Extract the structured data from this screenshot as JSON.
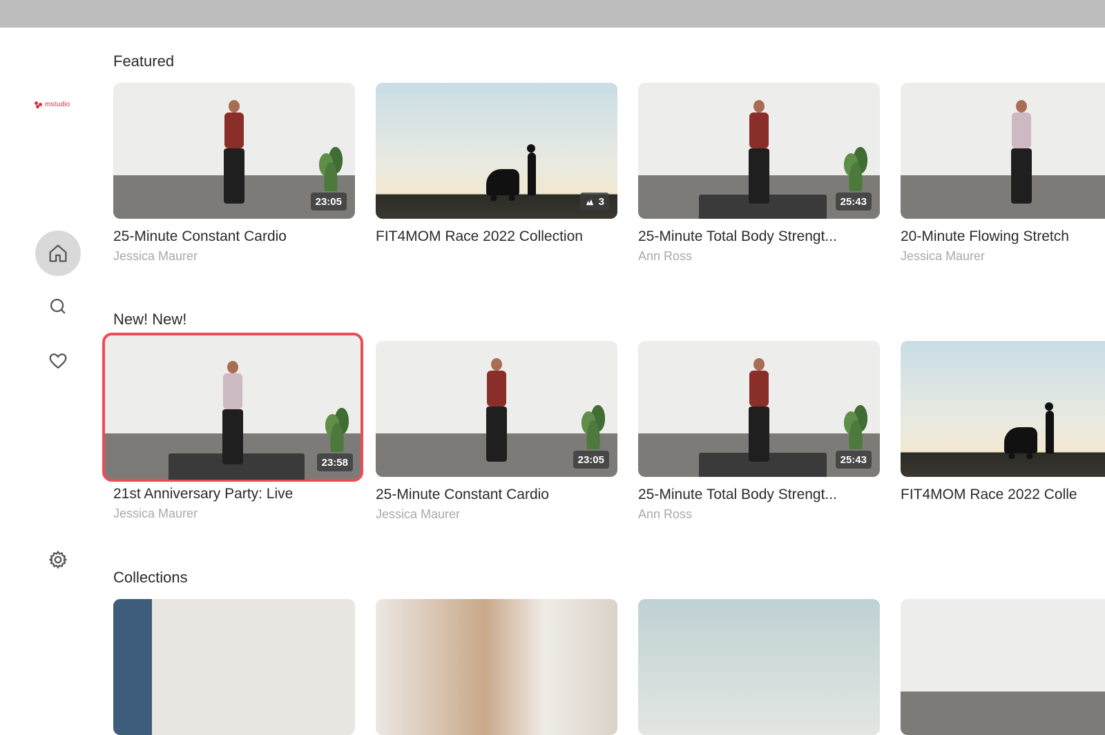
{
  "app": {
    "logo_text": "mstudio",
    "brand_color": "#d92c3a",
    "focus_color": "#ef4b57"
  },
  "nav": {
    "items": [
      {
        "name": "home",
        "icon": "home-icon",
        "active": true
      },
      {
        "name": "search",
        "icon": "search-icon",
        "active": false
      },
      {
        "name": "favorites",
        "icon": "heart-icon",
        "active": false
      },
      {
        "name": "settings",
        "icon": "gear-icon",
        "active": false
      }
    ]
  },
  "rows": [
    {
      "title": "Featured",
      "cards": [
        {
          "title": "25-Minute Constant Cardio",
          "subtitle": "Jessica Maurer",
          "badge": "23:05"
        },
        {
          "title": "FIT4MOM Race 2022 Collection",
          "subtitle": "",
          "badge": "3",
          "badge_icon": "collection-icon"
        },
        {
          "title": "25-Minute Total Body Strengt...",
          "subtitle": "Ann Ross",
          "badge": "25:43"
        },
        {
          "title": "20-Minute Flowing Stretch",
          "subtitle": "Jessica Maurer",
          "badge": ""
        }
      ]
    },
    {
      "title": "New! New!",
      "cards": [
        {
          "title": "21st Anniversary Party: Live",
          "subtitle": "Jessica Maurer",
          "badge": "23:58",
          "focused": true
        },
        {
          "title": "25-Minute Constant Cardio",
          "subtitle": "Jessica Maurer",
          "badge": "23:05"
        },
        {
          "title": "25-Minute Total Body Strengt...",
          "subtitle": "Ann Ross",
          "badge": "25:43"
        },
        {
          "title": "FIT4MOM Race 2022 Colle",
          "subtitle": "",
          "badge": ""
        }
      ]
    },
    {
      "title": "Collections",
      "cards": [
        {
          "title": "",
          "subtitle": "",
          "badge": ""
        },
        {
          "title": "",
          "subtitle": "",
          "badge": ""
        },
        {
          "title": "",
          "subtitle": "",
          "badge": ""
        },
        {
          "title": "",
          "subtitle": "",
          "badge": ""
        }
      ]
    }
  ]
}
